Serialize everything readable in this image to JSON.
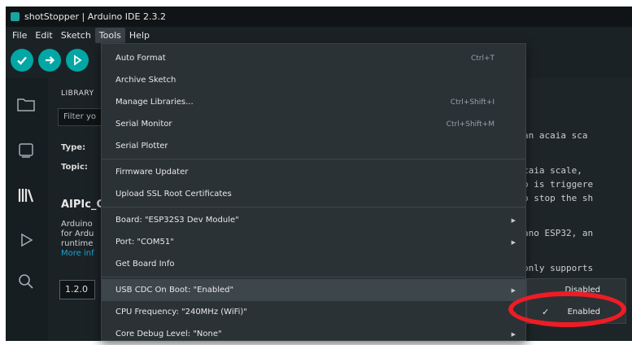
{
  "window": {
    "title": "shotStopper | Arduino IDE 2.3.2"
  },
  "menubar": {
    "items": [
      "File",
      "Edit",
      "Sketch",
      "Tools",
      "Help"
    ]
  },
  "toolbar": {
    "verify_icon": "check-icon",
    "upload_icon": "arrow-right-icon",
    "debug_icon": "debug-icon"
  },
  "activity_bar": {
    "icons": [
      "folder-icon",
      "boards-icon",
      "library-icon",
      "debug-icon",
      "search-icon"
    ]
  },
  "library": {
    "title": "LIBRARY",
    "filter_placeholder": "Filter yo",
    "type_label": "Type:",
    "topic_label": "Topic:",
    "lib_name": "AIPIc_C",
    "desc_lines": [
      "Arduino",
      "for Ardu",
      "runtime"
    ],
    "more_info": "More inf",
    "version": "1.2.0"
  },
  "editor": {
    "code_fragments": [
      "an acaia sca",
      "caia scale,",
      "o is triggere",
      "o stop the sh",
      "ano ESP32, an",
      "only supports"
    ]
  },
  "tools_menu": {
    "items": [
      {
        "label": "Auto Format",
        "shortcut": "Ctrl+T"
      },
      {
        "label": "Archive Sketch",
        "shortcut": ""
      },
      {
        "label": "Manage Libraries...",
        "shortcut": "Ctrl+Shift+I"
      },
      {
        "label": "Serial Monitor",
        "shortcut": "Ctrl+Shift+M"
      },
      {
        "label": "Serial Plotter",
        "shortcut": ""
      },
      {
        "label": "Firmware Updater",
        "shortcut": ""
      },
      {
        "label": "Upload SSL Root Certificates",
        "shortcut": ""
      },
      {
        "label": "Board: \"ESP32S3 Dev Module\"",
        "submenu": true
      },
      {
        "label": "Port: \"COM51\"",
        "submenu": true
      },
      {
        "label": "Get Board Info",
        "submenu": false
      },
      {
        "label": "USB CDC On Boot: \"Enabled\"",
        "submenu": true,
        "highlighted": true
      },
      {
        "label": "CPU Frequency: \"240MHz (WiFi)\"",
        "submenu": true
      },
      {
        "label": "Core Debug Level: \"None\"",
        "submenu": true
      }
    ]
  },
  "submenu": {
    "items": [
      {
        "label": "Disabled",
        "checked": false
      },
      {
        "label": "Enabled",
        "checked": true
      }
    ],
    "check_glyph": "✓"
  },
  "colors": {
    "accent": "#00a7a5",
    "annotation": "#ee1c24"
  }
}
